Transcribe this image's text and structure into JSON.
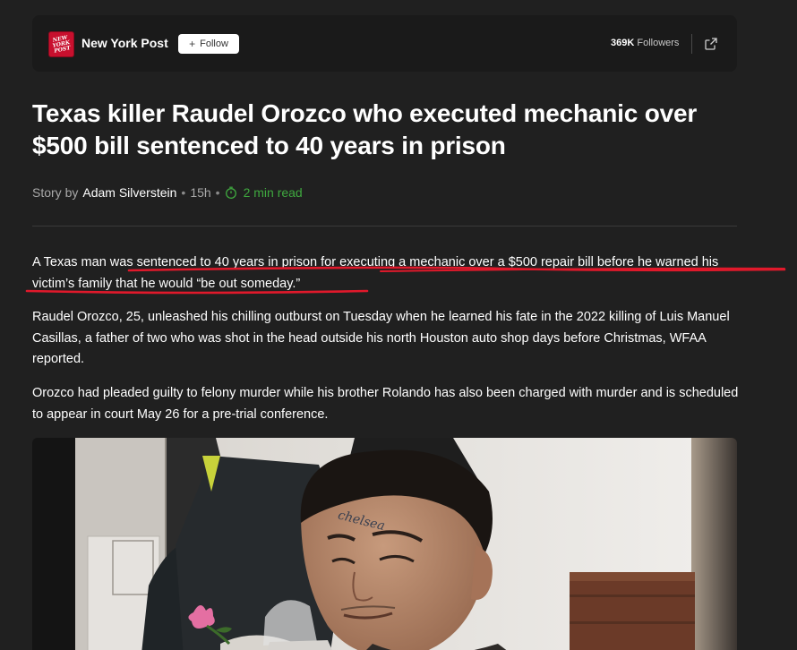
{
  "publisher": {
    "logo_text": "NEW YORK POST",
    "name": "New York Post",
    "follow_label": "Follow",
    "followers_count": "369K",
    "followers_label": "Followers"
  },
  "article": {
    "headline": "Texas killer Raudel Orozco who executed mechanic over $500 bill sentenced to 40 years in prison",
    "byline_prefix": "Story by",
    "author": "Adam Silverstein",
    "age": "15h",
    "read_time": "2 min read",
    "paragraphs": [
      "A Texas man was sentenced to 40 years in prison for executing a mechanic over a $500 repair bill before he warned his victim’s family that he would “be out someday.”",
      "Raudel Orozco, 25, unleashed his chilling outburst on Tuesday when he learned his fate in the 2022 killing of Luis Manuel Casillas, a father of two who was shot in the head outside his north Houston auto shop days before Christmas, WFAA reported.",
      "Orozco had pleaded guilty to felony murder while his brother Rolando has also been charged with murder and is scheduled to appear in court May 26 for a pre-trial conference."
    ],
    "photo_tattoo": "chelsea"
  },
  "colors": {
    "background": "#202020",
    "publisher_bar": "#1a1a1a",
    "logo_red": "#c8102e",
    "read_time_green": "#3fa83f",
    "markup_red": "#e0192b"
  }
}
